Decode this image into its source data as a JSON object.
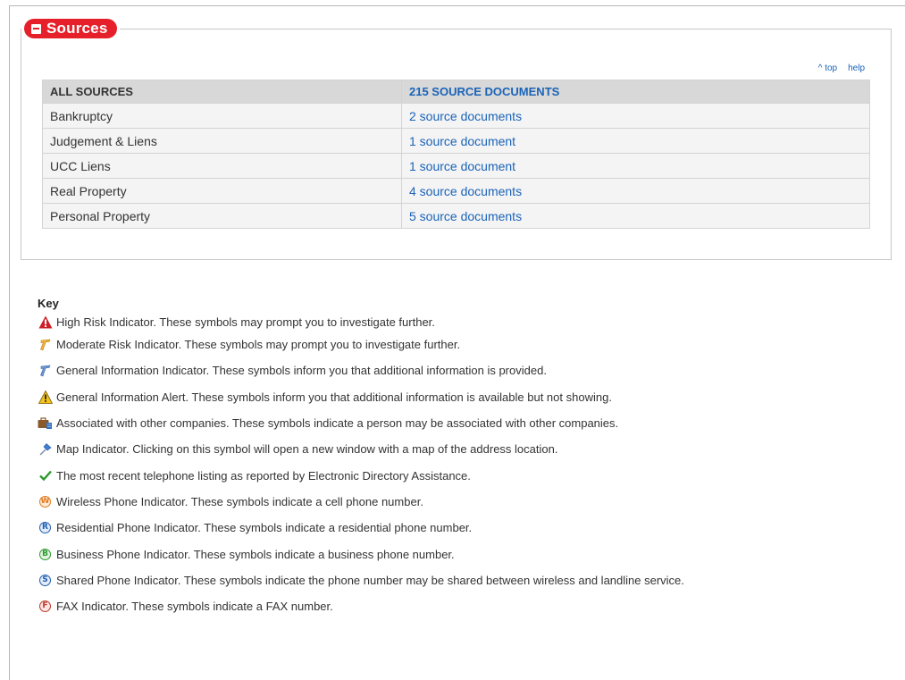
{
  "sources": {
    "title": "Sources",
    "top_link": "^ top",
    "help_link": "help",
    "header": {
      "category": "ALL SOURCES",
      "documents": "215 SOURCE DOCUMENTS"
    },
    "rows": [
      {
        "category": "Bankruptcy",
        "documents": "2 source documents"
      },
      {
        "category": "Judgement & Liens",
        "documents": "1 source document"
      },
      {
        "category": "UCC Liens",
        "documents": "1 source document"
      },
      {
        "category": "Real Property",
        "documents": "4 source documents"
      },
      {
        "category": "Personal Property",
        "documents": "5 source documents"
      }
    ]
  },
  "key": {
    "title": "Key",
    "items": [
      {
        "icon": "high-risk-icon",
        "text": "High Risk Indicator. These symbols may prompt you to investigate further."
      },
      {
        "icon": "moderate-risk-icon",
        "text": "Moderate Risk Indicator. These symbols may prompt you to investigate further."
      },
      {
        "icon": "general-info-icon",
        "text": "General Information Indicator. These symbols inform you that additional information is provided."
      },
      {
        "icon": "general-alert-icon",
        "text": "General Information Alert. These symbols inform you that additional information is available but not showing."
      },
      {
        "icon": "associated-companies-icon",
        "text": "Associated with other companies. These symbols indicate a person may be associated with other companies."
      },
      {
        "icon": "map-pin-icon",
        "text": "Map Indicator. Clicking on this symbol will open a new window with a map of the address location."
      },
      {
        "icon": "checkmark-icon",
        "text": "The most recent telephone listing as reported by Electronic Directory Assistance."
      },
      {
        "icon": "wireless-phone-icon",
        "text": "Wireless Phone Indicator. These symbols indicate a cell phone number."
      },
      {
        "icon": "residential-phone-icon",
        "text": "Residential Phone Indicator. These symbols indicate a residential phone number."
      },
      {
        "icon": "business-phone-icon",
        "text": "Business Phone Indicator. These symbols indicate a business phone number."
      },
      {
        "icon": "shared-phone-icon",
        "text": "Shared Phone Indicator. These symbols indicate the phone number may be shared between wireless and landline service."
      },
      {
        "icon": "fax-icon",
        "text": "FAX Indicator. These symbols indicate a FAX number."
      }
    ],
    "badge_letters": {
      "wireless": "W",
      "residential": "R",
      "business": "B",
      "shared": "S",
      "fax": "F"
    }
  },
  "colors": {
    "header_red": "#e6202a",
    "link_blue": "#1a63b8",
    "wireless": "#e07b1f",
    "residential": "#1f5fb0",
    "business": "#2e9a2e",
    "shared": "#1f5fb0",
    "fax": "#c0392b"
  }
}
